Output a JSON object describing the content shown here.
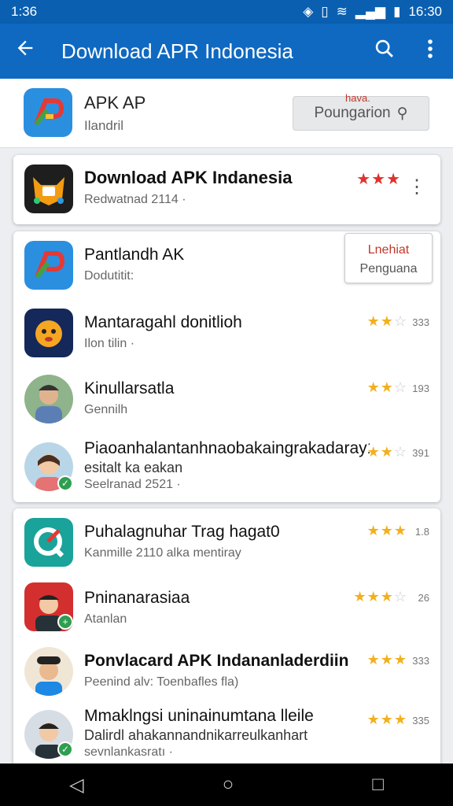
{
  "status": {
    "time_left": "1:36",
    "time_right": "16:30",
    "icons": [
      "nfc-icon",
      "vibrate-icon",
      "wifi-icon",
      "signal-icon",
      "battery-icon"
    ]
  },
  "appbar": {
    "title": "Download APR Indonesia",
    "back_icon": "back-arrow-icon",
    "search_icon": "search-icon",
    "menu_icon": "overflow-menu-icon"
  },
  "hero": {
    "title": "APK AP",
    "subtitle": "Ilandril",
    "chip_tag": "hava.",
    "chip_label": "Poungarion"
  },
  "featured": {
    "name": "Download APK Indanesia",
    "sub": "Redwatnad 2114 ·",
    "rating": 3
  },
  "list1": {
    "pill_top": "Lnehiat",
    "pill_bottom": "Penguana",
    "items": [
      {
        "name": "Pantlandh AK",
        "sub": "Dodutitit:",
        "rating": 0,
        "count": ""
      },
      {
        "name": "Mantaragahl donitlioh",
        "sub": "Ilon tilin ·",
        "rating": 2.5,
        "count": "333"
      },
      {
        "name": "Kinullarsatla",
        "sub": "Gennilh",
        "rating": 2.5,
        "count": "193"
      },
      {
        "name": "Piaoanhalantanhnaobakaingrakadaray1",
        "sub2": "esitalt ka eakan",
        "sub": "Seelranad 2521 ·",
        "rating": 2.5,
        "count": "391"
      }
    ]
  },
  "list2": {
    "items": [
      {
        "name": "Puhalagnuhar Trag hagat0",
        "sub": "Kanmille 2110 alka mentiray",
        "rating": 3,
        "count": "1.8"
      },
      {
        "name": "Pninanarasiaa",
        "sub": "Atanlan",
        "rating": 3.5,
        "count": "26"
      },
      {
        "name": "Ponvlacard APK Indananladerdiin",
        "sub": "Peenind alv:  Toenbafles fla)",
        "rating": 3,
        "count": "333"
      },
      {
        "name": "Mmaklngsi uninainumtana lleile",
        "sub2": "Dalirdl ahakannandnikarreulkanhart",
        "sub": "sevnlankasratı ·",
        "rating": 3,
        "count": "335"
      }
    ]
  },
  "colors": {
    "appbar": "#0f69c1",
    "star": "#f2b01e",
    "star_featured": "#e0312b"
  }
}
